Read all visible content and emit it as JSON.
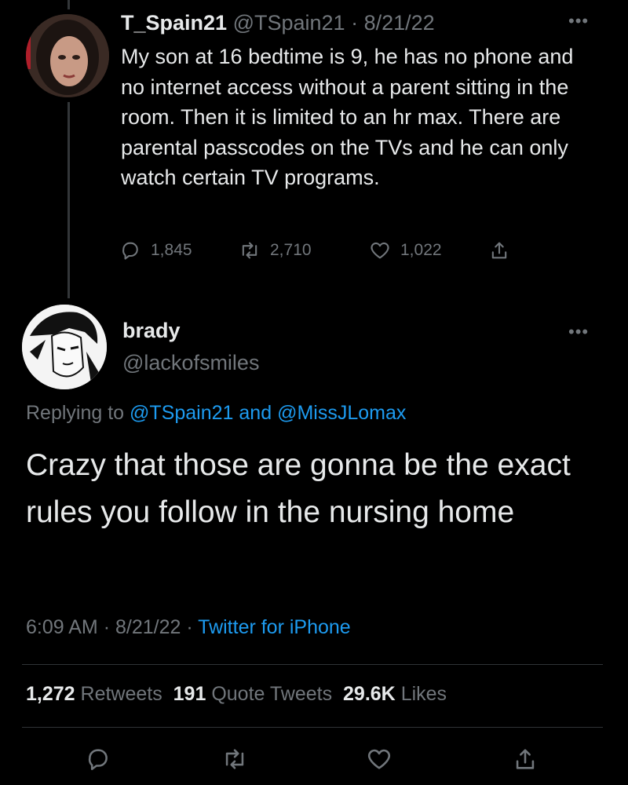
{
  "tweet1": {
    "display_name": "T_Spain21",
    "handle": "@TSpain21",
    "separator": "·",
    "date": "8/21/22",
    "more_icon": "more-icon",
    "body": "My son at 16 bedtime is 9, he has no phone and no internet access without a parent sitting in the room. Then it is limited to an hr max.  There are parental passcodes on the TVs and he can only watch certain TV programs.",
    "replies": "1,845",
    "retweets": "2,710",
    "likes": "1,022"
  },
  "tweet2": {
    "display_name": "brady",
    "handle": "@lackofsmiles",
    "replying_prefix": "Replying to",
    "replying_user1": "@TSpain21",
    "replying_and": "and",
    "replying_user2": "@MissJLomax",
    "body": "Crazy that those are gonna be the exact rules you follow in the nursing home",
    "time": "6:09 AM",
    "dot": "·",
    "date": "8/21/22",
    "source": "Twitter for iPhone",
    "retweet_count": "1,272",
    "retweet_label": "Retweets",
    "quote_count": "191",
    "quote_label": "Quote Tweets",
    "like_count": "29.6K",
    "like_label": "Likes"
  },
  "colors": {
    "background": "#000000",
    "text_primary": "#e7e9ea",
    "text_secondary": "#71767b",
    "link": "#1d9bf0"
  }
}
